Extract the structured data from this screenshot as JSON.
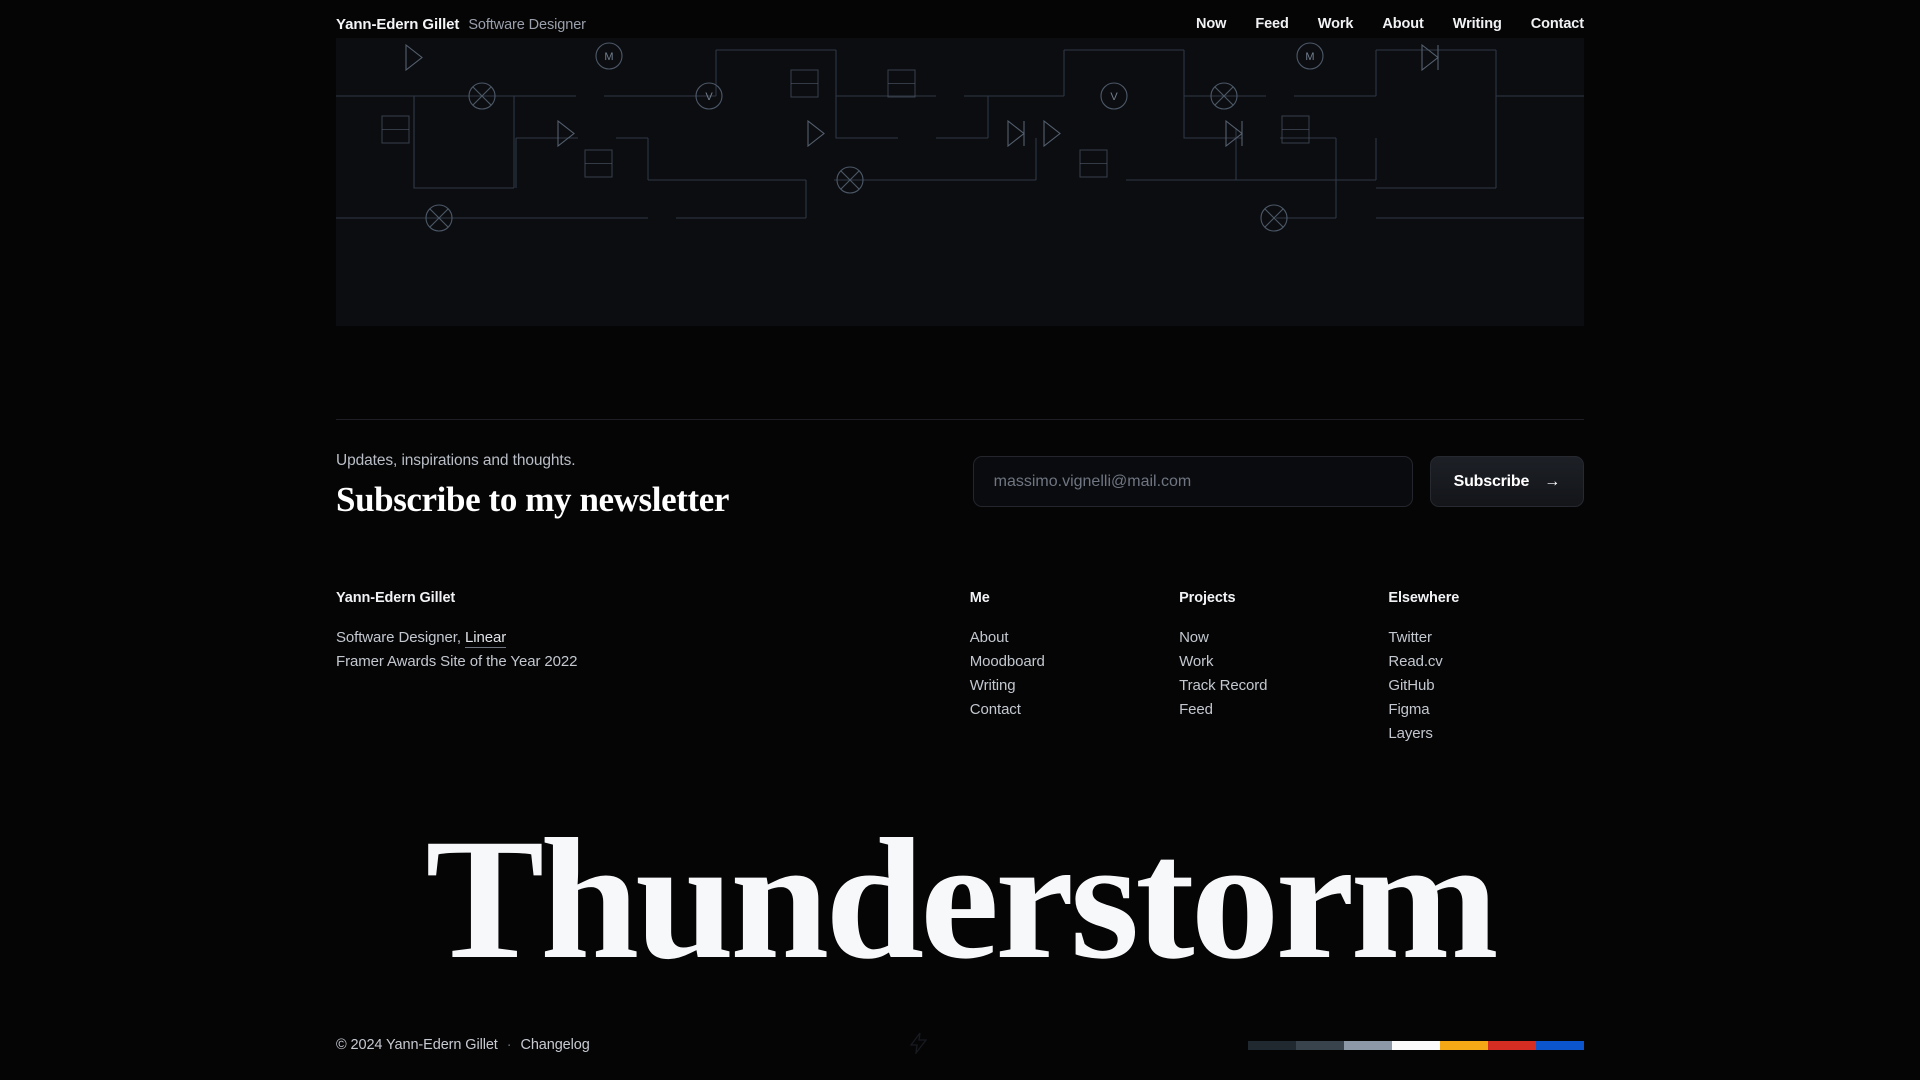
{
  "header": {
    "brand_name": "Yann-Edern Gillet",
    "brand_role": "Software Designer",
    "nav": [
      {
        "label": "Now"
      },
      {
        "label": "Feed"
      },
      {
        "label": "Work"
      },
      {
        "label": "About"
      },
      {
        "label": "Writing"
      },
      {
        "label": "Contact"
      }
    ]
  },
  "hero": {
    "graphic_name": "circuit-schematic-illustration",
    "background": "#0c0d11",
    "stroke": "#2e3642",
    "symbol_labels": [
      "M",
      "V",
      "M",
      "V"
    ]
  },
  "newsletter": {
    "kicker": "Updates, inspirations and thoughts.",
    "title": "Subscribe to my newsletter",
    "email_placeholder": "massimo.vignelli@mail.com",
    "email_value": "",
    "subscribe_label": "Subscribe",
    "arrow": "→"
  },
  "footer": {
    "brand_name": "Yann-Edern Gillet",
    "role_prefix": "Software Designer,",
    "role_link": "Linear",
    "award": "Framer Awards Site of the Year 2022",
    "columns": [
      {
        "heading": "Me",
        "links": [
          {
            "label": "About"
          },
          {
            "label": "Moodboard"
          },
          {
            "label": "Writing"
          },
          {
            "label": "Contact"
          }
        ]
      },
      {
        "heading": "Projects",
        "links": [
          {
            "label": "Now"
          },
          {
            "label": "Work"
          },
          {
            "label": "Track Record"
          },
          {
            "label": "Feed"
          }
        ]
      },
      {
        "heading": "Elsewhere",
        "links": [
          {
            "label": "Twitter"
          },
          {
            "label": "Read.cv"
          },
          {
            "label": "GitHub"
          },
          {
            "label": "Figma"
          },
          {
            "label": "Layers"
          }
        ]
      }
    ]
  },
  "wordmark": {
    "text": "Thunderstorm"
  },
  "bottombar": {
    "copyright": "© 2024 Yann-Edern Gillet",
    "separator": "·",
    "changelog_label": "Changelog",
    "bolt_icon": "lightning-bolt-icon",
    "swatches": [
      {
        "color": "#202830"
      },
      {
        "color": "#39434b"
      },
      {
        "color": "#8d98a6"
      },
      {
        "color": "#fbfbfc"
      },
      {
        "color": "#f5a815"
      },
      {
        "color": "#d62d22"
      },
      {
        "color": "#0b55ce"
      }
    ]
  }
}
